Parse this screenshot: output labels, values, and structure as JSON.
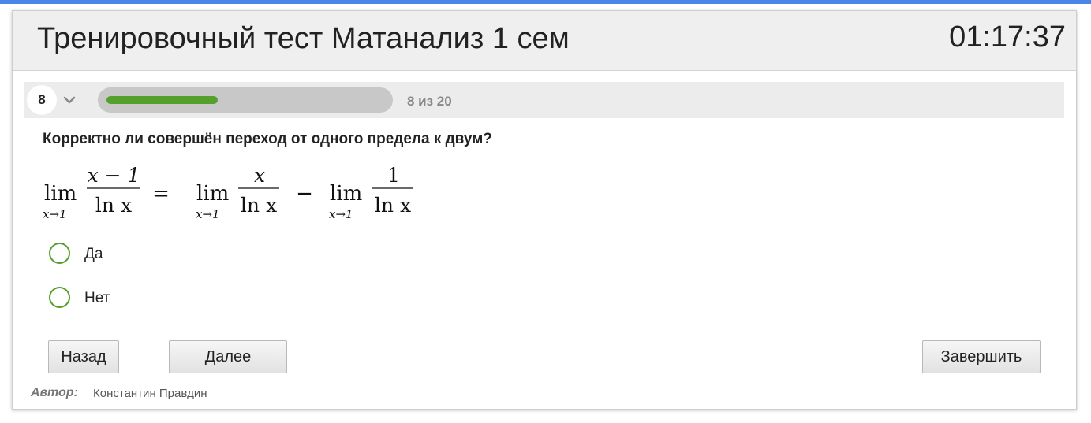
{
  "colors": {
    "accent_strip": "#4a86e8",
    "progress_fill": "#55a02c",
    "radio_border": "#55a02c",
    "header_bg": "#efefef"
  },
  "header": {
    "title": "Тренировочный тест Матанализ 1 сем",
    "timer": "01:17:37"
  },
  "navigation": {
    "current_question": "8",
    "dropdown_icon": "chevron-down-icon",
    "progress_fraction": 0.4,
    "progress_text": "8 из 20"
  },
  "question": {
    "text": "Корректно ли совершён переход от одного предела к двум?",
    "formula": {
      "lim": "lim",
      "sub": "x→1",
      "term1_num": "x − 1",
      "term1_den": "ln x",
      "equals": "=",
      "term2_num": "x",
      "term2_den": "ln x",
      "minus": "−",
      "term3_num": "1",
      "term3_den": "ln x"
    }
  },
  "options": [
    {
      "label": "Да",
      "selected": false
    },
    {
      "label": "Нет",
      "selected": false
    }
  ],
  "buttons": {
    "back": "Назад",
    "next": "Далее",
    "finish": "Завершить"
  },
  "footer": {
    "author_label": "Автор:",
    "author_name": "Константин Правдин"
  }
}
